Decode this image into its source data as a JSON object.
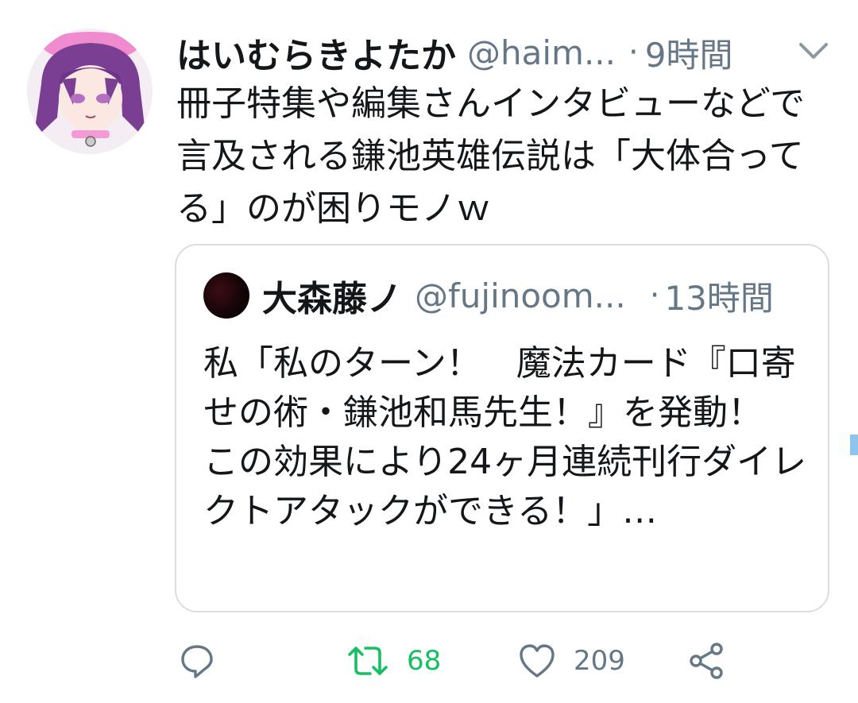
{
  "colors": {
    "text": "#14171a",
    "secondary": "#657786",
    "retweet": "#17bf63",
    "border": "#d9dee2",
    "icon": "#657786"
  },
  "tweet": {
    "author_name": "はいむらきよたか",
    "handle": "@haim...",
    "separator": "·",
    "time": "9時間",
    "text": "冊子特集や編集さんインタビューなどで言及される鎌池英雄伝説は「大体合ってる」のが困りモノｗ",
    "menu_icon": "chevron-down-icon"
  },
  "quoted_tweet": {
    "author_name": "大森藤ノ",
    "handle": "@fujinoom...",
    "separator": "·",
    "time": "13時間",
    "text": "私「私のターン！　魔法カード『口寄せの術・鎌池和馬先生！』を発動！　この効果により24ヶ月連続刊行ダイレクトアタックができる！」…"
  },
  "actions": {
    "reply_icon": "reply-icon",
    "retweet_icon": "retweet-icon",
    "retweet_count": "68",
    "like_icon": "heart-icon",
    "like_count": "209",
    "share_icon": "share-icon"
  }
}
